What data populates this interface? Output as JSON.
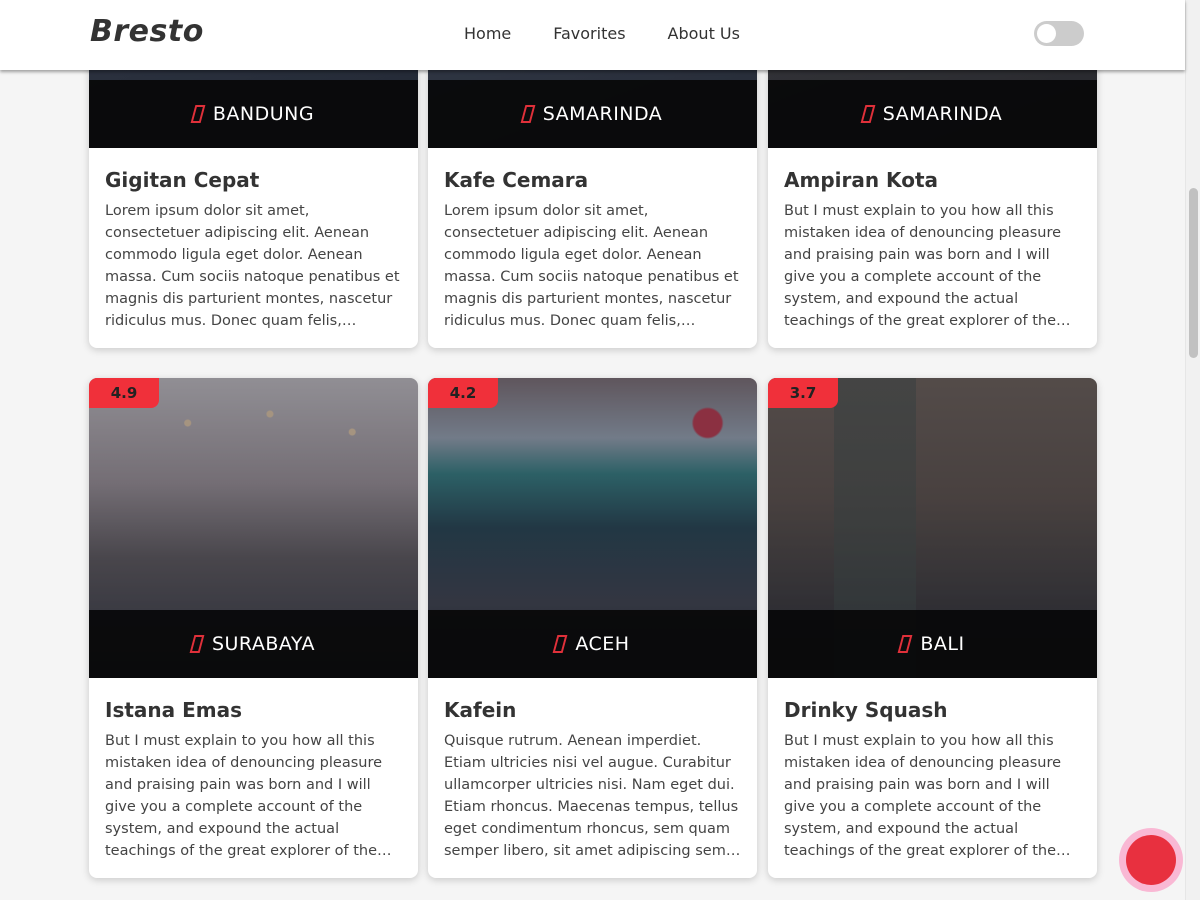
{
  "header": {
    "brand": "Bresto",
    "nav": [
      "Home",
      "Favorites",
      "About Us"
    ]
  },
  "colors": {
    "accent": "#f0303a",
    "fab_ring": "#f9b8d4",
    "fab_core": "#e8303f"
  },
  "restaurants": [
    {
      "name": "Gigitan Cepat",
      "city": "BANDUNG",
      "rating": "",
      "description": "Lorem ipsum dolor sit amet, consectetuer adipiscing elit. Aenean commodo ligula eget dolor. Aenean massa. Cum sociis natoque penatibus et magnis dis parturient montes, nascetur ridiculus mus. Donec quam felis, ultricies nec,…"
    },
    {
      "name": "Kafe Cemara",
      "city": "SAMARINDA",
      "rating": "",
      "description": "Lorem ipsum dolor sit amet, consectetuer adipiscing elit. Aenean commodo ligula eget dolor. Aenean massa. Cum sociis natoque penatibus et magnis dis parturient montes, nascetur ridiculus mus. Donec quam felis, ultricies nec,…"
    },
    {
      "name": "Ampiran Kota",
      "city": "SAMARINDA",
      "rating": "",
      "description": "But I must explain to you how all this mistaken idea of denouncing pleasure and praising pain was born and I will give you a complete account of the system, and expound the actual teachings of the great explorer of the truth, the master-builde…"
    },
    {
      "name": "Istana Emas",
      "city": "SURABAYA",
      "rating": "4.9",
      "description": "But I must explain to you how all this mistaken idea of denouncing pleasure and praising pain was born and I will give you a complete account of the system, and expound the actual teachings of the great explorer of the truth, the master-builde…"
    },
    {
      "name": "Kafein",
      "city": "ACEH",
      "rating": "4.2",
      "description": "Quisque rutrum. Aenean imperdiet. Etiam ultricies nisi vel augue. Curabitur ullamcorper ultricies nisi. Nam eget dui. Etiam rhoncus. Maecenas tempus, tellus eget condimentum rhoncus, sem quam semper libero, sit amet adipiscing sem…"
    },
    {
      "name": "Drinky Squash",
      "city": "BALI",
      "rating": "3.7",
      "description": "But I must explain to you how all this mistaken idea of denouncing pleasure and praising pain was born and I will give you a complete account of the system, and expound the actual teachings of the great explorer of the truth, the master-builde…"
    }
  ]
}
